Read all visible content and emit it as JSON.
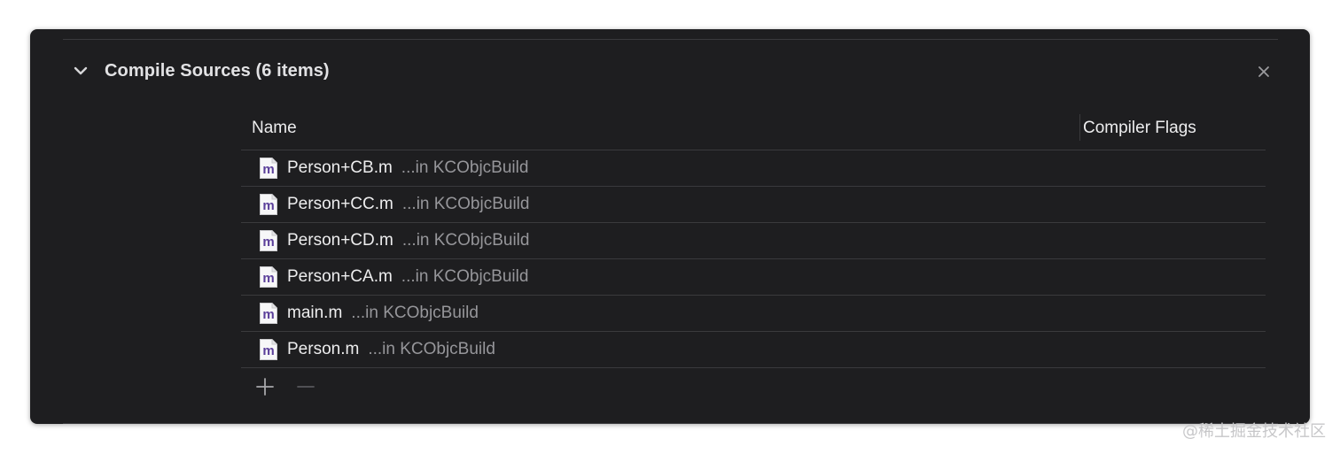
{
  "section": {
    "title": "Compile Sources (6 items)",
    "expanded": true,
    "disclosure_icon": "chevron-down-icon",
    "close_icon": "close-icon"
  },
  "table": {
    "columns": {
      "name": "Name",
      "flags": "Compiler Flags"
    },
    "rows": [
      {
        "file": "Person+CB.m",
        "location": "...in KCObjcBuild",
        "flags": ""
      },
      {
        "file": "Person+CC.m",
        "location": "...in KCObjcBuild",
        "flags": ""
      },
      {
        "file": "Person+CD.m",
        "location": "...in KCObjcBuild",
        "flags": ""
      },
      {
        "file": "Person+CA.m",
        "location": "...in KCObjcBuild",
        "flags": ""
      },
      {
        "file": "main.m",
        "location": "...in KCObjcBuild",
        "flags": ""
      },
      {
        "file": "Person.m",
        "location": "...in KCObjcBuild",
        "flags": ""
      }
    ],
    "file_icon": "objc-m-file-icon"
  },
  "controls": {
    "add_icon": "plus-icon",
    "remove_icon": "minus-icon"
  },
  "watermark": "@稀土掘金技术社区",
  "colors": {
    "panel_bg": "#1e1e20",
    "text_primary": "#ededee",
    "text_secondary": "#96969a",
    "divider": "#3a3a3d",
    "file_icon_letter": "#5b3f9a"
  }
}
